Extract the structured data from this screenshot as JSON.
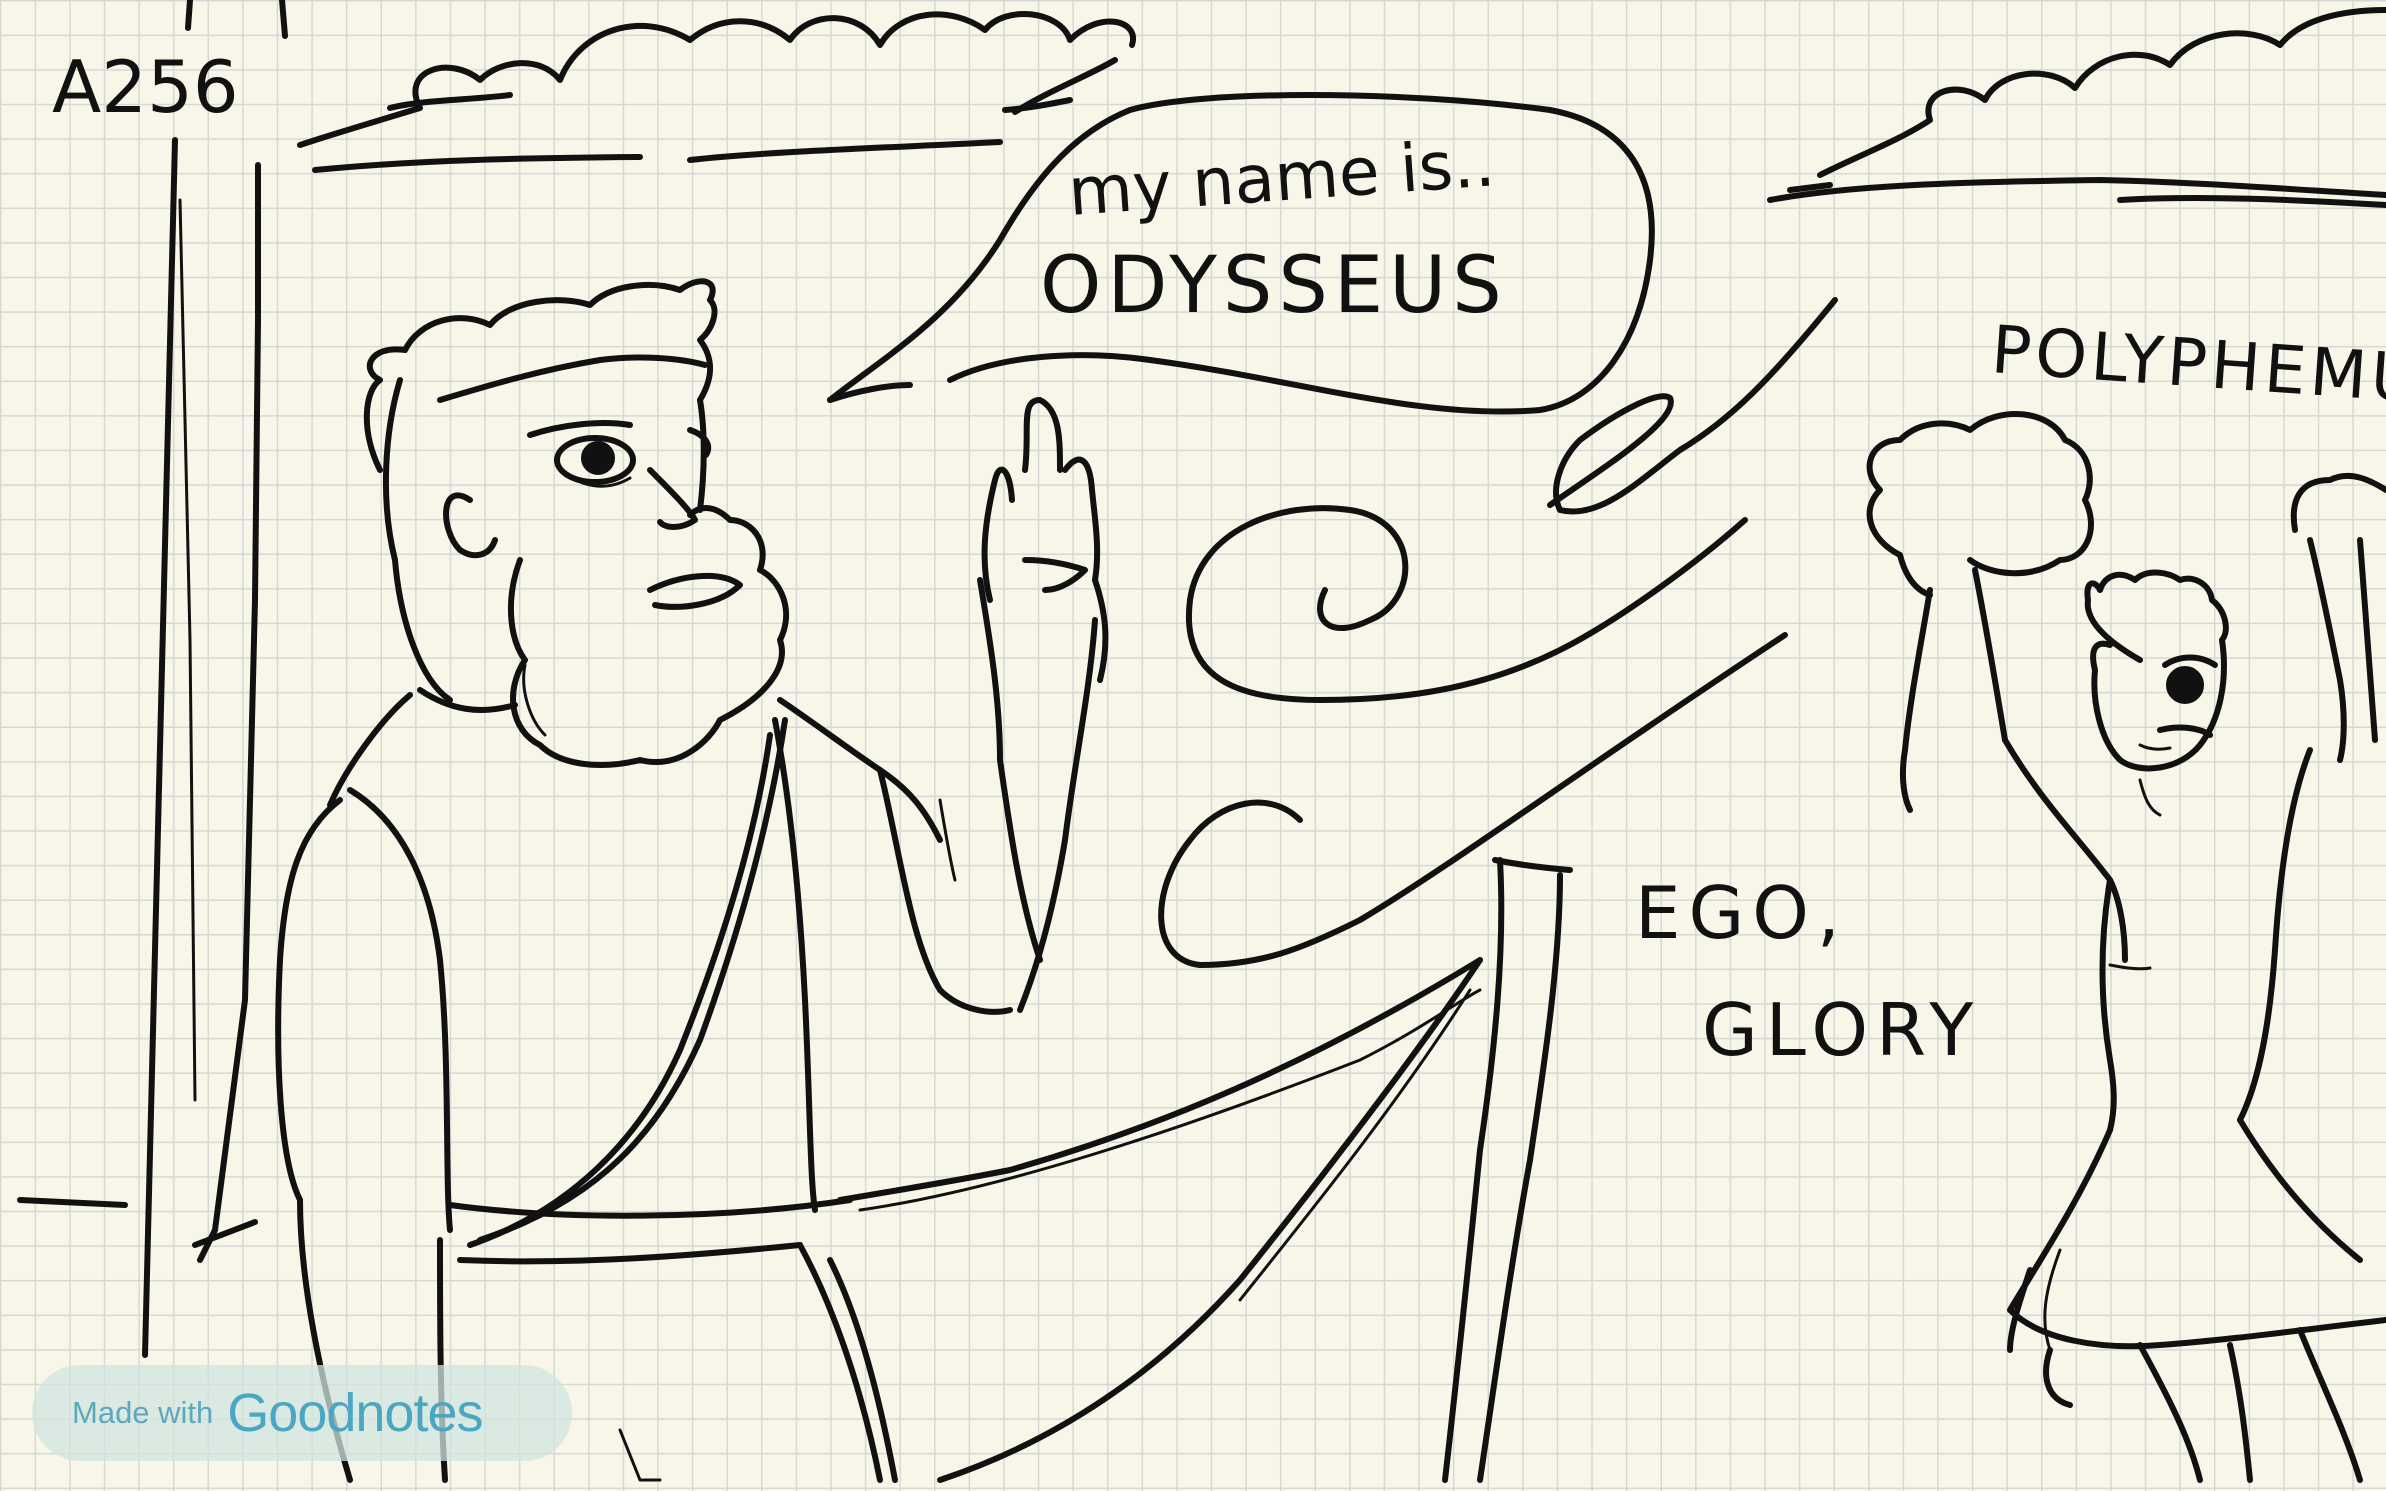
{
  "sketch": {
    "page_label": "A256",
    "speech_line1": "my name is..",
    "speech_line2": "ODYSSEUS",
    "name_label": "POLYPHEMUS",
    "caption_line1": "EGO,",
    "caption_line2": "GLORY"
  },
  "watermark": {
    "prefix": "Made with",
    "brand": "Goodnotes"
  },
  "colors": {
    "paper": "#f8f6e9",
    "grid": "#d5d8d4",
    "ink": "#111111",
    "watermark_bg": "#d0e4de",
    "watermark_text": "#4aa7c3"
  }
}
